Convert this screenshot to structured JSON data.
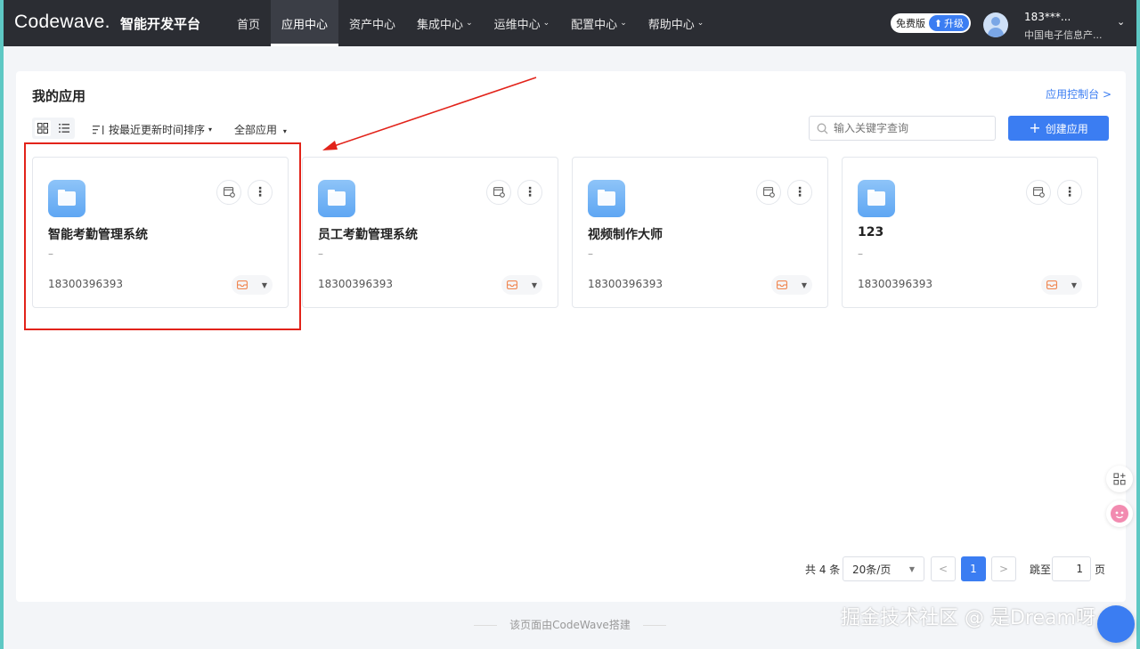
{
  "header": {
    "logo": "Codewave.",
    "platform": "智能开发平台",
    "nav": [
      {
        "label": "首页",
        "dropdown": false,
        "active": false
      },
      {
        "label": "应用中心",
        "dropdown": false,
        "active": true
      },
      {
        "label": "资产中心",
        "dropdown": false,
        "active": false
      },
      {
        "label": "集成中心",
        "dropdown": true,
        "active": false
      },
      {
        "label": "运维中心",
        "dropdown": true,
        "active": false
      },
      {
        "label": "配置中心",
        "dropdown": true,
        "active": false
      },
      {
        "label": "帮助中心",
        "dropdown": true,
        "active": false
      }
    ],
    "plan": "免费版",
    "upgrade": "升级",
    "user_name": "183***...",
    "user_org": "中国电子信息产..."
  },
  "main": {
    "title": "我的应用",
    "console_link": "应用控制台 >",
    "sort_label": "按最近更新时间排序",
    "filter_label": "全部应用",
    "search_placeholder": "输入关键字查询",
    "create_label": "创建应用",
    "apps": [
      {
        "name": "智能考勤管理系统",
        "desc": "–",
        "owner": "18300396393"
      },
      {
        "name": "员工考勤管理系统",
        "desc": "–",
        "owner": "18300396393"
      },
      {
        "name": "视频制作大师",
        "desc": "–",
        "owner": "18300396393"
      },
      {
        "name": "123",
        "desc": "–",
        "owner": "18300396393"
      }
    ]
  },
  "pagination": {
    "total": "共 4 条",
    "page_size": "20条/页",
    "current_page": "1",
    "prev": "<",
    "next": ">",
    "jump_label": "跳至",
    "jump_value": "1",
    "page_suffix": "页"
  },
  "footer": "该页面由CodeWave搭建",
  "watermark": "掘金技术社区 @ 是Dream呀",
  "colors": {
    "accent": "#3b7df2",
    "topbar": "#2b2d33",
    "highlight": "#e2231a"
  }
}
